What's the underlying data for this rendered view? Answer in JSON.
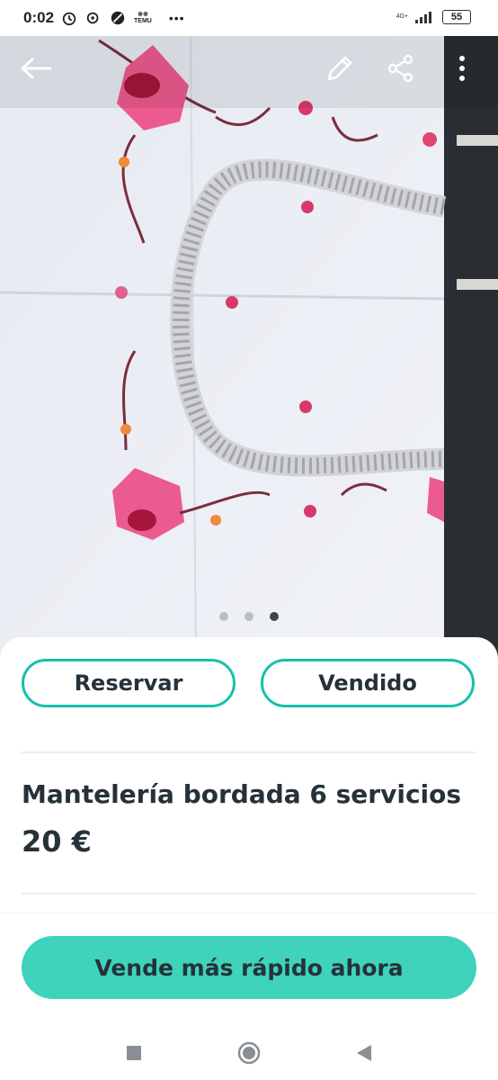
{
  "status_bar": {
    "time": "0:02",
    "temu_label": "TEMU",
    "network": "4G+",
    "battery": "55",
    "overflow": "•••"
  },
  "header": {
    "icons": [
      "back-arrow-icon",
      "edit-pencil-icon",
      "share-icon",
      "more-vertical-icon"
    ]
  },
  "gallery": {
    "image_count": 3,
    "active_index": 3
  },
  "actions": {
    "reserve_label": "Reservar",
    "sold_label": "Vendido"
  },
  "listing": {
    "title": "Mantelería bordada 6 servicios",
    "price": "20 €"
  },
  "cta": {
    "label": "Vende más rápido ahora"
  },
  "colors": {
    "accent": "#13c1ac",
    "cta_bg": "#3fd3bb",
    "text": "#253238"
  }
}
